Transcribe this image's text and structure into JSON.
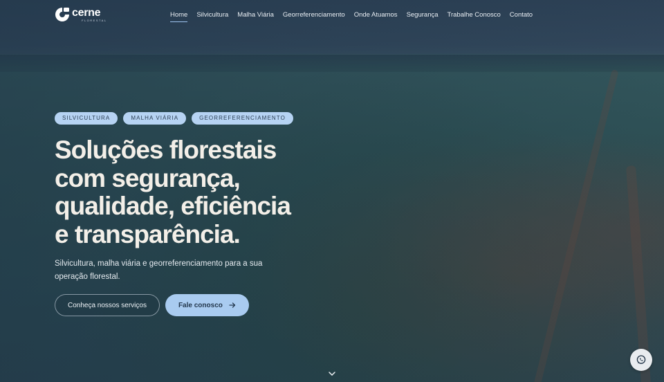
{
  "brand": {
    "name": "cerne",
    "tagline": "FLORESTAL"
  },
  "nav": {
    "items": [
      {
        "label": "Home",
        "active": true
      },
      {
        "label": "Silvicultura"
      },
      {
        "label": "Malha Viária"
      },
      {
        "label": "Georreferenciamento"
      },
      {
        "label": "Onde Atuamos"
      },
      {
        "label": "Segurança"
      },
      {
        "label": "Trabalhe Conosco"
      },
      {
        "label": "Contato"
      }
    ]
  },
  "hero": {
    "tags": [
      "SILVICULTURA",
      "MALHA VIÁRIA",
      "GEORREFERENCIAMENTO"
    ],
    "headline_lines": [
      "Soluções florestais",
      "com segurança,",
      "qualidade, eficiência",
      "e transparência."
    ],
    "subtitle_lines": [
      "Silvicultura, malha viária e georreferenciamento para a sua",
      "operação florestal."
    ],
    "cta_secondary": "Conheça nossos serviços",
    "cta_primary": "Fale conosco"
  },
  "icons": {
    "scroll": "chevron-down-icon",
    "primary_cta": "arrow-right-icon",
    "floating": "whatsapp-icon",
    "logo": "cerne-logo-icon"
  },
  "colors": {
    "tag_bg": "#b6d3f3",
    "primary_button": "#a9cbf0",
    "headline": "#f3efe8",
    "overlay": "#1e3446"
  }
}
